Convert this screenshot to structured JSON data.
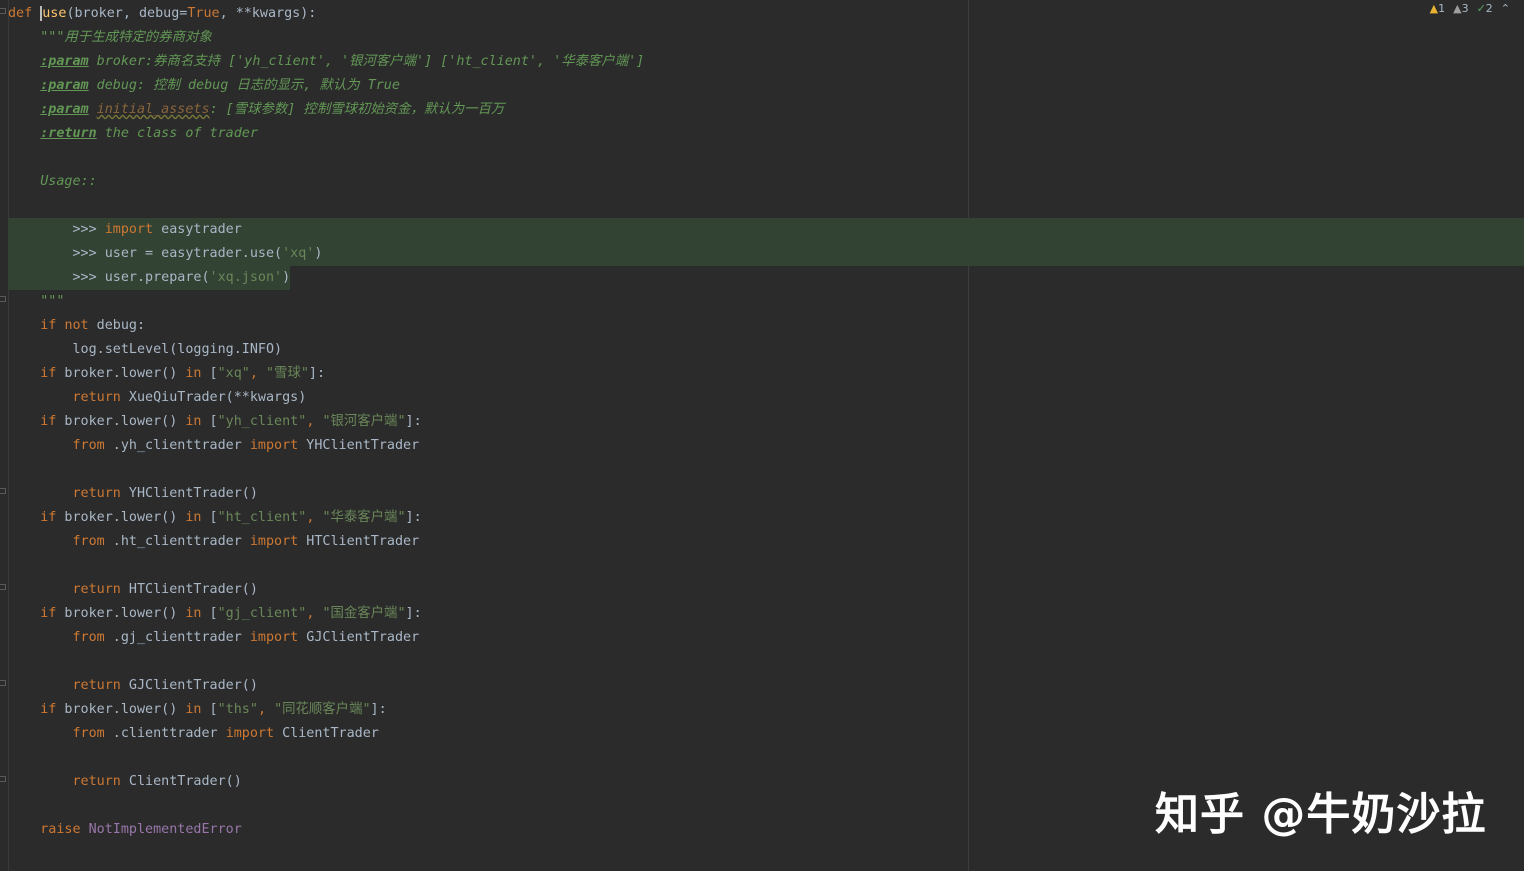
{
  "inspections": {
    "warnings": "1",
    "weak_warnings": "3",
    "typos": "2"
  },
  "watermark": "知乎 @牛奶沙拉",
  "code": {
    "l1": {
      "def": "def ",
      "name": "use",
      "open": "(broker, debug=",
      "true": "True",
      "rest": ", **kwargs):"
    },
    "l2": "    \"\"\"用于生成特定的券商对象",
    "l3": {
      "indent": "    ",
      "tag": ":param",
      "text": " broker:券商名支持 ['yh_client', '银河客户端'] ['ht_client', '华泰客户端']"
    },
    "l4": {
      "indent": "    ",
      "tag": ":param",
      "text": " debug: 控制 debug 日志的显示, 默认为 True"
    },
    "l5": {
      "indent": "    ",
      "tag": ":param",
      "sp": " ",
      "param": "initial_assets",
      "text": ": [雪球参数] 控制雪球初始资金，默认为一百万"
    },
    "l6": {
      "indent": "    ",
      "tag": ":return",
      "text": " the class of trader"
    },
    "l8": "    Usage::",
    "l10": {
      "indent": "        >>> ",
      "kw": "import",
      "rest": " easytrader"
    },
    "l11": {
      "pre": "        >>> user = easytrader.use(",
      "str": "'xq'",
      "post": ")"
    },
    "l12": {
      "pre": "        >>> user.prepare(",
      "str": "'xq.json'",
      "post": ")"
    },
    "l13": "    \"\"\"",
    "l14": {
      "indent": "    ",
      "if": "if",
      "sp": " ",
      "not": "not",
      "rest": " debug:"
    },
    "l15": "        log.setLevel(logging.INFO)",
    "l16": {
      "indent": "    ",
      "if": "if",
      "mid": " broker.lower() ",
      "in": "in",
      "open": " [",
      "s1": "\"xq\"",
      "comma": ", ",
      "s2": "\"雪球\"",
      "close": "]:"
    },
    "l17": {
      "indent": "        ",
      "ret": "return",
      "rest": " XueQiuTrader(**kwargs)"
    },
    "l18": {
      "indent": "    ",
      "if": "if",
      "mid": " broker.lower() ",
      "in": "in",
      "open": " [",
      "s1": "\"yh_client\"",
      "comma": ", ",
      "s2": "\"银河客户端\"",
      "close": "]:"
    },
    "l19": {
      "indent": "        ",
      "from": "from",
      "mod": " .yh_clienttrader ",
      "imp": "import",
      "cls": " YHClientTrader"
    },
    "l21": {
      "indent": "        ",
      "ret": "return",
      "rest": " YHClientTrader()"
    },
    "l22": {
      "indent": "    ",
      "if": "if",
      "mid": " broker.lower() ",
      "in": "in",
      "open": " [",
      "s1": "\"ht_client\"",
      "comma": ", ",
      "s2": "\"华泰客户端\"",
      "close": "]:"
    },
    "l23": {
      "indent": "        ",
      "from": "from",
      "mod": " .ht_clienttrader ",
      "imp": "import",
      "cls": " HTClientTrader"
    },
    "l25": {
      "indent": "        ",
      "ret": "return",
      "rest": " HTClientTrader()"
    },
    "l26": {
      "indent": "    ",
      "if": "if",
      "mid": " broker.lower() ",
      "in": "in",
      "open": " [",
      "s1": "\"gj_client\"",
      "comma": ", ",
      "s2": "\"国金客户端\"",
      "close": "]:"
    },
    "l27": {
      "indent": "        ",
      "from": "from",
      "mod": " .gj_clienttrader ",
      "imp": "import",
      "cls": " GJClientTrader"
    },
    "l29": {
      "indent": "        ",
      "ret": "return",
      "rest": " GJClientTrader()"
    },
    "l30": {
      "indent": "    ",
      "if": "if",
      "mid": " broker.lower() ",
      "in": "in",
      "open": " [",
      "s1": "\"ths\"",
      "comma": ", ",
      "s2": "\"同花顺客户端\"",
      "close": "]:"
    },
    "l31": {
      "indent": "        ",
      "from": "from",
      "mod": " .clienttrader ",
      "imp": "import",
      "cls": " ClientTrader"
    },
    "l33": {
      "indent": "        ",
      "ret": "return",
      "rest": " ClientTrader()"
    },
    "l35": {
      "indent": "    ",
      "raise": "raise",
      "sp": " ",
      "err": "NotImplementedError"
    }
  }
}
